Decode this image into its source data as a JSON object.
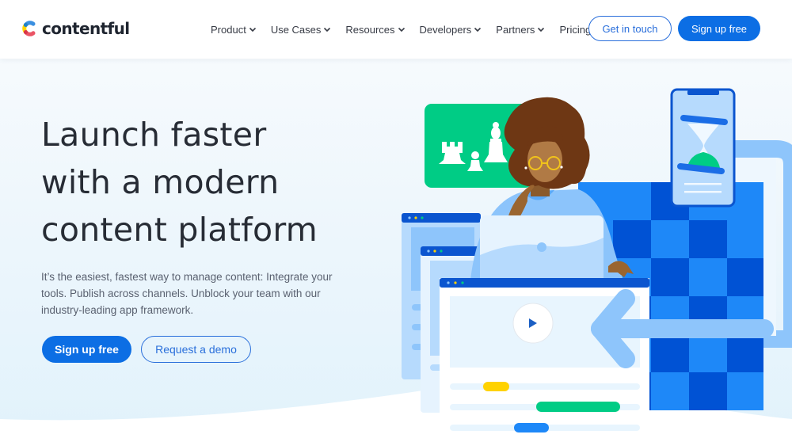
{
  "brand": {
    "name": "contentful",
    "logo_colors": {
      "yellow": "#ffda00",
      "blue": "#0681b6",
      "red": "#eb5a68",
      "teal": "#65c5ea"
    }
  },
  "nav": {
    "items": [
      {
        "label": "Product",
        "has_dropdown": true
      },
      {
        "label": "Use Cases",
        "has_dropdown": true
      },
      {
        "label": "Resources",
        "has_dropdown": true
      },
      {
        "label": "Developers",
        "has_dropdown": true
      },
      {
        "label": "Partners",
        "has_dropdown": true
      },
      {
        "label": "Pricing",
        "has_dropdown": false
      }
    ],
    "get_in_touch_label": "Get in touch",
    "sign_up_label": "Sign up free"
  },
  "hero": {
    "headline_lines": [
      "Launch faster",
      "with a modern",
      "content platform"
    ],
    "subtext": "It’s the easiest, fastest way to manage content: Integrate your tools. Publish across channels. Unblock your team with our industry-leading app framework.",
    "primary_cta": "Sign up free",
    "secondary_cta": "Request a demo"
  },
  "illustration": {
    "icons": [
      "chess-pieces-icon",
      "hourglass-icon",
      "play-icon",
      "arrow-left-icon"
    ],
    "colors": {
      "accent_blue": "#0c6ee4",
      "dark_blue": "#0050d0",
      "light_blue": "#8cc4fb",
      "green": "#00cc80",
      "yellow": "#ffd200"
    }
  }
}
